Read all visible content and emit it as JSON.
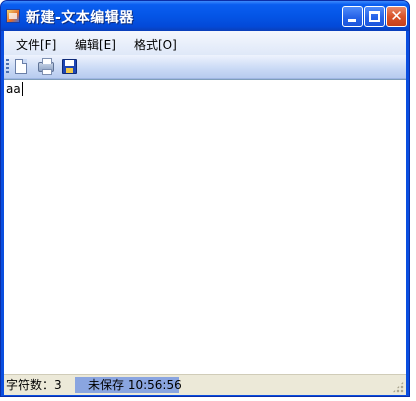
{
  "window": {
    "title": "新建-文本编辑器",
    "title_color": "#0455e6"
  },
  "menubar": {
    "items": [
      {
        "label": "文件[F]"
      },
      {
        "label": "编辑[E]"
      },
      {
        "label": "格式[O]"
      }
    ]
  },
  "toolbar": {
    "buttons": [
      {
        "icon": "new-document-icon"
      },
      {
        "icon": "print-icon"
      },
      {
        "icon": "save-icon"
      }
    ]
  },
  "editor": {
    "content": "aa"
  },
  "statusbar": {
    "char_count": "字符数：3",
    "save_status": "未保存 10:56:56",
    "save_status_color": "#8aa5e0"
  }
}
